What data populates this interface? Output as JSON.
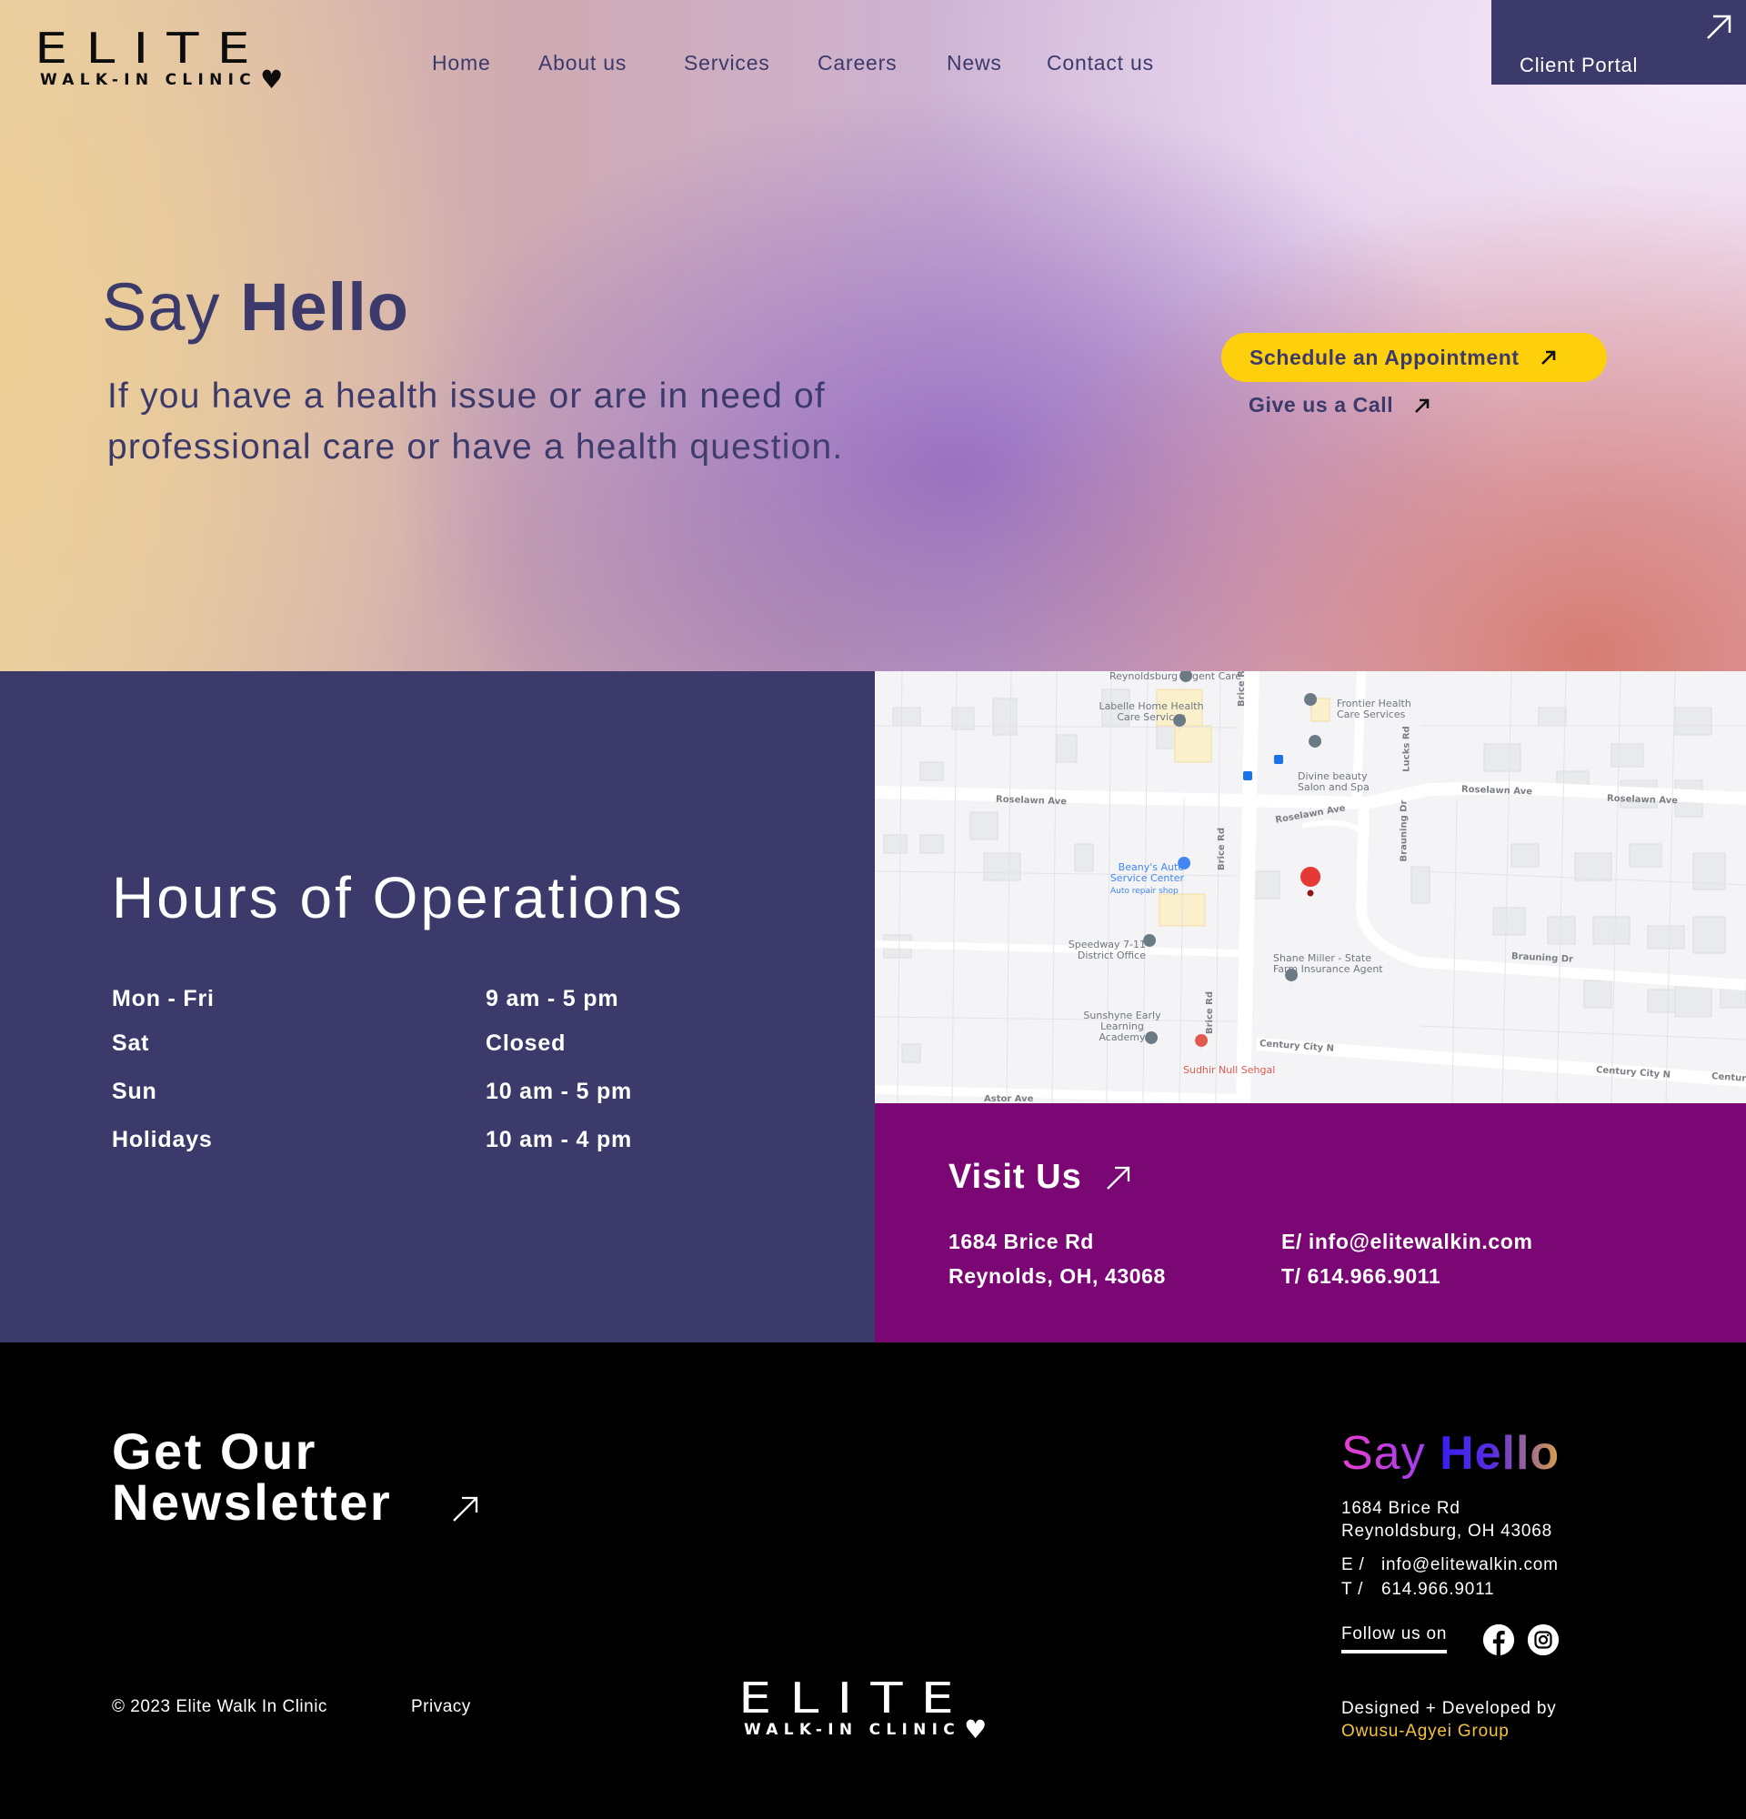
{
  "brand": {
    "name": "ELITE",
    "tagline": "WALK-IN CLINIC",
    "heart": "♥"
  },
  "nav": {
    "items": [
      {
        "label": "Home"
      },
      {
        "label": "About us"
      },
      {
        "label": "Services"
      },
      {
        "label": "Careers"
      },
      {
        "label": "News"
      },
      {
        "label": "Contact us"
      }
    ],
    "portal_label": "Client Portal"
  },
  "hero": {
    "title_light": "Say",
    "title_bold": "Hello",
    "text": "If you have a health issue or are in need of professional care or have a health question.",
    "cta_label": "Schedule an Appointment",
    "call_label": "Give us a Call"
  },
  "hours": {
    "title": "Hours of Operations",
    "rows": [
      {
        "day": "Mon - Fri",
        "time": "9 am - 5 pm"
      },
      {
        "day": "Sat",
        "time": "Closed"
      },
      {
        "day": "Sun",
        "time": "10 am - 5 pm"
      },
      {
        "day": "Holidays",
        "time": "10 am - 4 pm"
      }
    ]
  },
  "map": {
    "places": [
      {
        "name": "Reynoldsburg Urgent Care"
      },
      {
        "name": "Labelle Home Health Care Services"
      },
      {
        "name": "Frontier Health Care Services"
      },
      {
        "name": "Divine beauty Salon and Spa"
      },
      {
        "name": "Beany's Auto Service Center",
        "sub": "Auto repair shop"
      },
      {
        "name": "Speedway 7-11 District Office"
      },
      {
        "name": "Shane Miller - State Farm Insurance Agent"
      },
      {
        "name": "Sunshyne Early Learning Academy"
      },
      {
        "name": "Sudhir Null Sehgal"
      }
    ],
    "roads": [
      "Roselawn Ave",
      "Brice Rd",
      "Lucks Rd",
      "Brauning Dr",
      "Century City N",
      "Astor Ave"
    ]
  },
  "visit": {
    "title": "Visit Us",
    "address1": "1684 Brice Rd",
    "address2": "Reynolds, OH, 43068",
    "email": "E/ info@elitewalkin.com",
    "phone": "T/ 614.966.9011"
  },
  "footer": {
    "newsletter_line1": "Get Our",
    "newsletter_line2": "Newsletter",
    "say_light": "Say",
    "say_bold": "Hello",
    "address1": "1684 Brice Rd",
    "address2": "Reynoldsburg, OH 43068",
    "email_key": "E /",
    "email": "info@elitewalkin.com",
    "phone_key": "T /",
    "phone": "614.966.9011",
    "follow_label": "Follow us on",
    "copyright": "© 2023 Elite Walk In Clinic",
    "privacy": "Privacy",
    "designed_by": "Designed + Developed by",
    "designer": "Owusu-Agyei Group"
  },
  "colors": {
    "navy": "#3b3a6b",
    "purple": "#7a0774",
    "yellow": "#fdd00b",
    "gold": "#f6c23a"
  }
}
